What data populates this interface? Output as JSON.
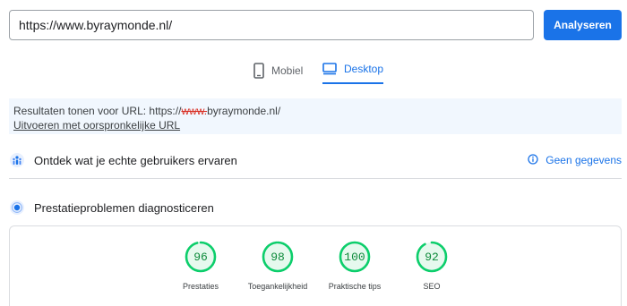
{
  "search": {
    "url_value": "https://www.byraymonde.nl/",
    "analyze_label": "Analyseren"
  },
  "tabs": {
    "mobile_label": "Mobiel",
    "desktop_label": "Desktop",
    "active": "desktop"
  },
  "notice": {
    "prefix": "Resultaten tonen voor URL: https://",
    "struck": "www.",
    "suffix": "byraymonde.nl/",
    "link_label": "Uitvoeren met oorspronkelijke URL"
  },
  "crux": {
    "title": "Ontdek wat je echte gebruikers ervaren",
    "no_data_label": "Geen gegevens"
  },
  "diagnostics": {
    "title": "Prestatieproblemen diagnosticeren"
  },
  "scores": [
    {
      "value": 96,
      "label": "Prestaties"
    },
    {
      "value": 98,
      "label": "Toegankelijkheid"
    },
    {
      "value": 100,
      "label": "Praktische tips"
    },
    {
      "value": 92,
      "label": "SEO"
    }
  ],
  "colors": {
    "accent": "#1a73e8",
    "score_good": "#0cce6b",
    "score_good_text": "#0c8a3a",
    "score_good_bg": "#e6f9ee"
  }
}
